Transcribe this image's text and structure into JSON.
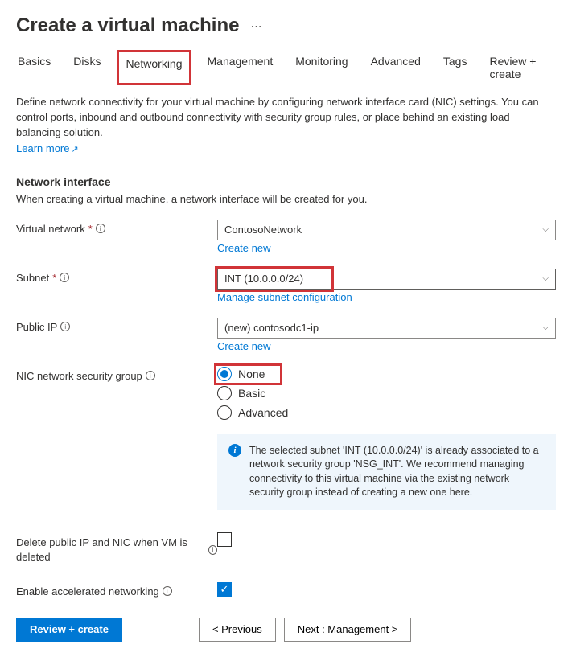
{
  "header": {
    "title": "Create a virtual machine"
  },
  "tabs": {
    "basics": "Basics",
    "disks": "Disks",
    "networking": "Networking",
    "management": "Management",
    "monitoring": "Monitoring",
    "advanced": "Advanced",
    "tags": "Tags",
    "review": "Review + create"
  },
  "intro": {
    "text": "Define network connectivity for your virtual machine by configuring network interface card (NIC) settings. You can control ports, inbound and outbound connectivity with security group rules, or place behind an existing load balancing solution.",
    "learn_more": "Learn more"
  },
  "network_interface": {
    "title": "Network interface",
    "desc": "When creating a virtual machine, a network interface will be created for you."
  },
  "fields": {
    "vnet": {
      "label": "Virtual network",
      "value": "ContosoNetwork",
      "create_new": "Create new"
    },
    "subnet": {
      "label": "Subnet",
      "value": "INT (10.0.0.0/24)",
      "manage": "Manage subnet configuration"
    },
    "public_ip": {
      "label": "Public IP",
      "value": "(new) contosodc1-ip",
      "create_new": "Create new"
    },
    "nsg": {
      "label": "NIC network security group",
      "options": {
        "none": "None",
        "basic": "Basic",
        "advanced": "Advanced"
      }
    },
    "delete_ip": {
      "label": "Delete public IP and NIC when VM is deleted"
    },
    "accel_net": {
      "label": "Enable accelerated networking"
    }
  },
  "info_box": {
    "text": "The selected subnet 'INT (10.0.0.0/24)' is already associated to a network security group 'NSG_INT'. We recommend managing connectivity to this virtual machine via the existing network security group instead of creating a new one here."
  },
  "footer": {
    "review": "Review + create",
    "previous": "< Previous",
    "next": "Next : Management >"
  }
}
